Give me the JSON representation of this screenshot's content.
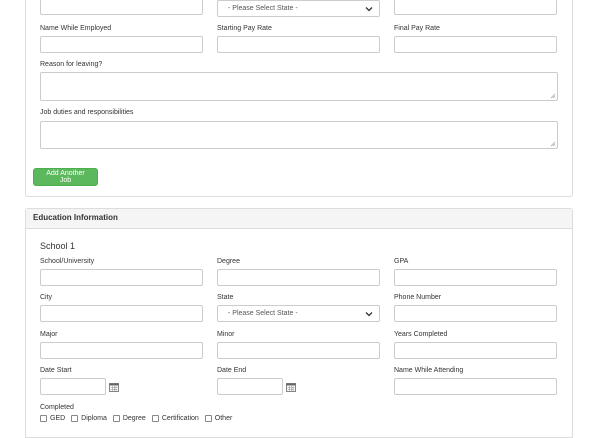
{
  "job": {
    "top_state_select": "- Please Select State -",
    "labels": {
      "name_while_employed": "Name While Employed",
      "starting_pay_rate": "Starting Pay Rate",
      "final_pay_rate": "Final Pay Rate",
      "reason_for_leaving": "Reason for leaving?",
      "job_duties": "Job duties and responsibilities"
    },
    "add_job_button": "Add Another Job"
  },
  "education": {
    "header": "Education Information",
    "school_title": "School 1",
    "labels": {
      "school_university": "School/University",
      "degree": "Degree",
      "gpa": "GPA",
      "city": "City",
      "state": "State",
      "phone_number": "Phone Number",
      "major": "Major",
      "minor": "Minor",
      "years_completed": "Years Completed",
      "date_start": "Date Start",
      "date_end": "Date End",
      "name_while_attending": "Name While Attending",
      "completed": "Completed"
    },
    "state_select": "- Please Select State -",
    "completed_options": [
      "GED",
      "Diploma",
      "Degree",
      "Certification",
      "Other"
    ]
  },
  "icons": {
    "calendar": "calendar-icon",
    "dropdown": "chevron-down-icon"
  },
  "colors": {
    "button_green": "#5cb85c",
    "border": "#cccccc",
    "panel_header": "#f5f5f5"
  }
}
